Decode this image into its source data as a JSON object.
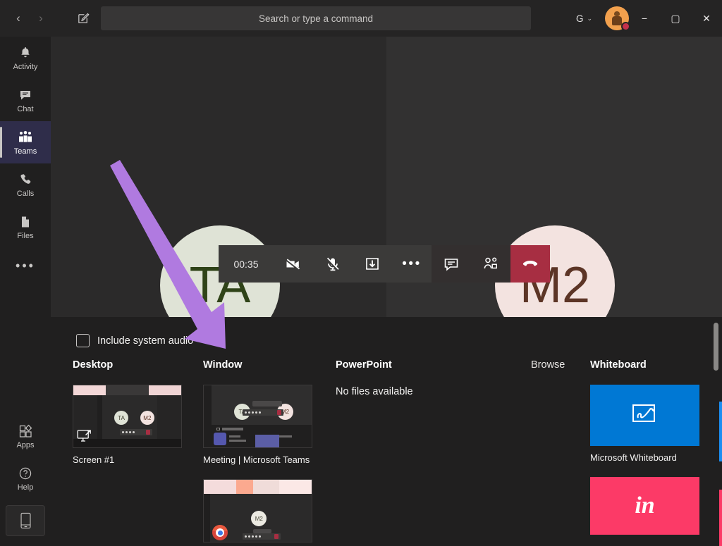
{
  "titlebar": {
    "back_label": "‹",
    "forward_label": "›",
    "compose_icon": "compose-icon",
    "search_placeholder": "Search or type a command",
    "org_label": "G",
    "org_chevron": "⌄",
    "minimize_label": "−",
    "maximize_label": "▢",
    "close_label": "✕"
  },
  "rail": {
    "items": [
      {
        "label": "Activity",
        "icon": "bell-icon",
        "active": false
      },
      {
        "label": "Chat",
        "icon": "chat-icon",
        "active": false
      },
      {
        "label": "Teams",
        "icon": "teams-icon",
        "active": true
      },
      {
        "label": "Calls",
        "icon": "phone-icon",
        "active": false
      },
      {
        "label": "Files",
        "icon": "files-icon",
        "active": false
      }
    ],
    "more_label": "•••",
    "bottom_items": [
      {
        "label": "Apps",
        "icon": "apps-icon"
      },
      {
        "label": "Help",
        "icon": "help-icon"
      }
    ],
    "device_icon": "mobile-device-icon"
  },
  "meeting": {
    "participants": [
      {
        "initials": "TA",
        "bg": "#dfe3d6",
        "fg": "#2f4318"
      },
      {
        "initials": "M2",
        "bg": "#f3e3e0",
        "fg": "#5c3526"
      }
    ],
    "controls": {
      "timer": "00:35",
      "buttons": [
        {
          "name": "camera-off-button",
          "icon": "camera-off-icon"
        },
        {
          "name": "mic-off-button",
          "icon": "mic-off-icon"
        },
        {
          "name": "share-screen-button",
          "icon": "share-tray-icon"
        },
        {
          "name": "more-options-button",
          "icon": "ellipsis-icon",
          "label": "•••"
        },
        {
          "name": "chat-button",
          "icon": "chat-bubble-icon"
        },
        {
          "name": "participants-button",
          "icon": "people-icon"
        },
        {
          "name": "hangup-button",
          "icon": "hangup-icon"
        }
      ]
    }
  },
  "tray": {
    "system_audio_label": "Include system audio",
    "system_audio_checked": false,
    "columns": {
      "desktop": {
        "heading": "Desktop",
        "items": [
          {
            "caption": "Screen #1"
          }
        ]
      },
      "window": {
        "heading": "Window",
        "items": [
          {
            "caption": "Meeting | Microsoft Teams"
          },
          {
            "caption": ""
          }
        ]
      },
      "powerpoint": {
        "heading": "PowerPoint",
        "empty_message": "No files available"
      },
      "browse": {
        "heading": "Browse"
      },
      "whiteboard": {
        "heading": "Whiteboard",
        "items": [
          {
            "caption": "Microsoft Whiteboard",
            "color": "#0078d4",
            "icon": "whiteboard-pen-icon"
          },
          {
            "caption": "",
            "color": "#fc3a67",
            "glyph": "in"
          }
        ]
      }
    }
  },
  "annotation": {
    "arrow_color": "#b07ae0"
  }
}
